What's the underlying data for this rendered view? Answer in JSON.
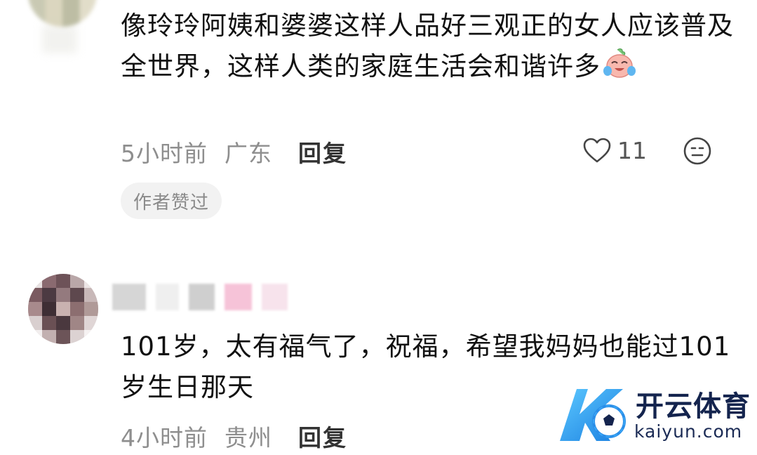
{
  "comments": [
    {
      "text": "像玲玲阿姨和婆婆这样人品好三观正的女人应该普及全世界，这样人类的家庭生活会和谐许多",
      "emoji_icon": "crying-laughing-emoji-icon",
      "time": "5小时前",
      "location": "广东",
      "reply_label": "回复",
      "like_count": "11",
      "badge": "作者赞过"
    },
    {
      "text": "101岁，太有福气了，祝福，希望我妈妈也能过101岁生日那天",
      "time": "4小时前",
      "location": "贵州",
      "reply_label": "回复"
    }
  ],
  "watermark": {
    "brand": "开云体育",
    "url": "kaiyun.com"
  },
  "colors": {
    "text": "#111111",
    "meta": "#8e8e8e",
    "badge_bg": "#f2f2f2",
    "watermark_blue": "#3aa6f5",
    "watermark_navy": "#14244e"
  }
}
